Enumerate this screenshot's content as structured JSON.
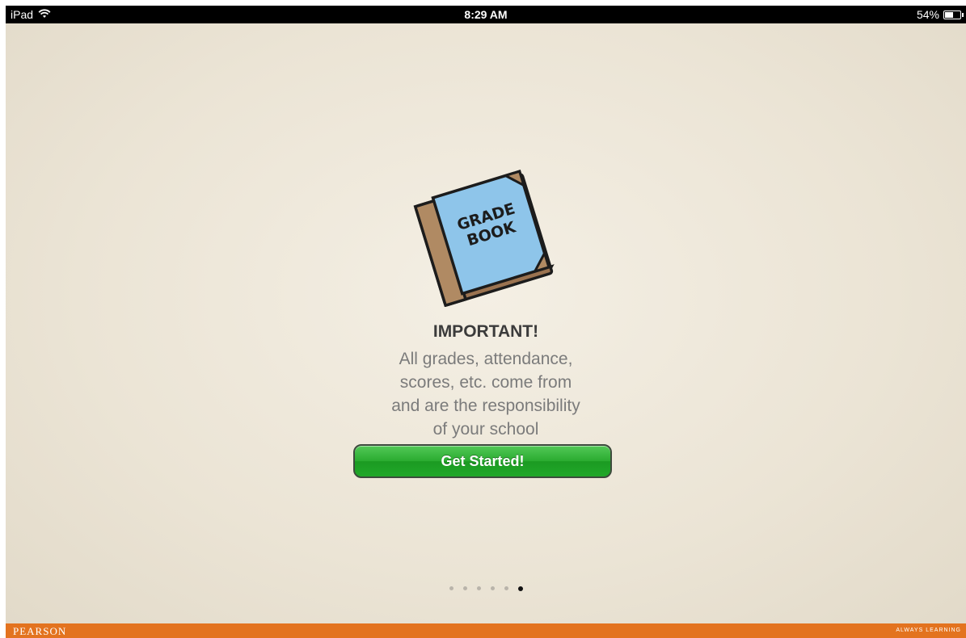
{
  "status_bar": {
    "device": "iPad",
    "time": "8:29 AM",
    "battery_text": "54%",
    "battery_level": 0.54,
    "wifi_icon": "wifi-icon",
    "battery_icon": "battery-icon"
  },
  "intro": {
    "illustration": {
      "icon": "grade-book-icon",
      "text_line1": "GRADE",
      "text_line2": "BOOK",
      "cover_color": "#8ec5ea",
      "binding_color": "#b08a63"
    },
    "heading": "IMPORTANT!",
    "message_lines": [
      "All grades, attendance,",
      "scores, etc. come from",
      "and are the responsibility",
      "of your school"
    ],
    "button_label": "Get Started!",
    "button_color": "#2aab30",
    "pages": {
      "total": 6,
      "current": 6
    }
  },
  "footer": {
    "brand": "PEARSON",
    "tagline": "ALWAYS LEARNING",
    "color": "#e3731f"
  }
}
